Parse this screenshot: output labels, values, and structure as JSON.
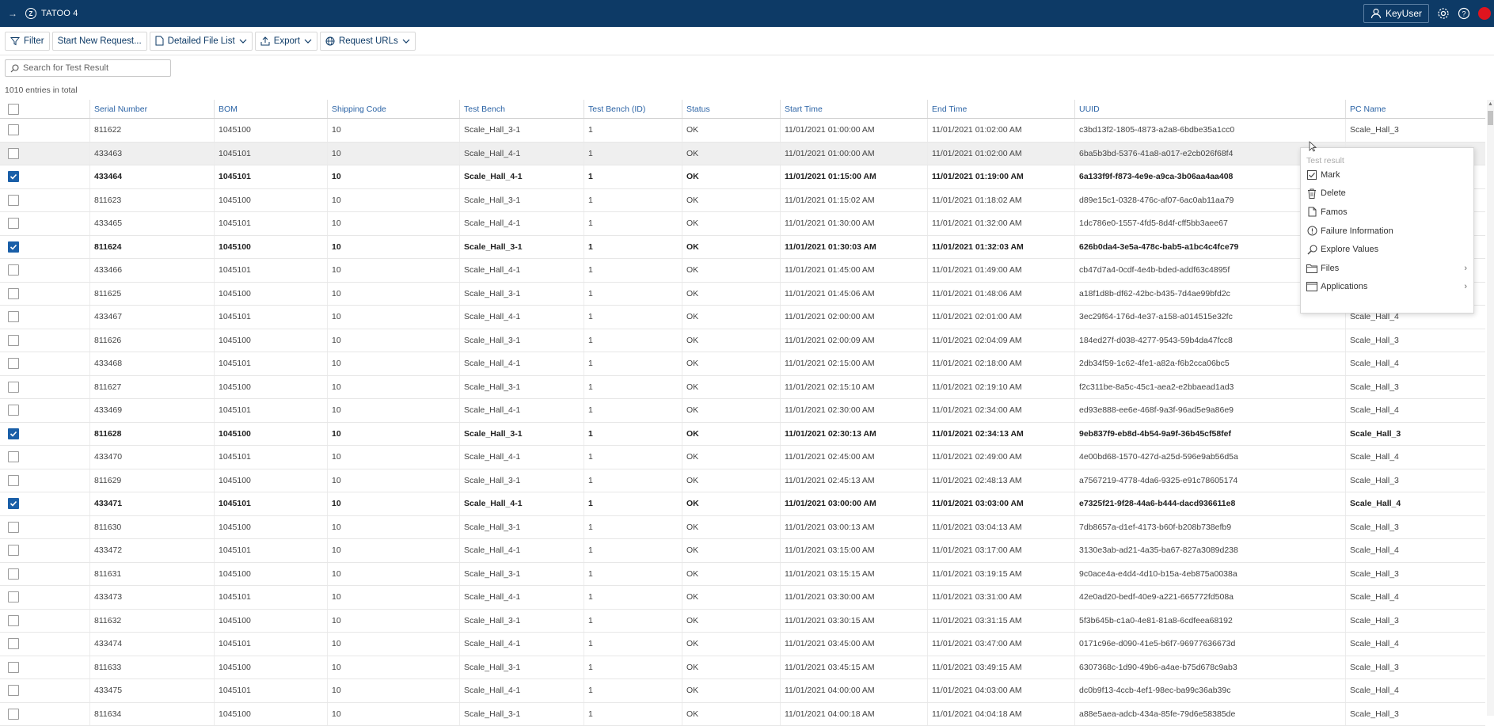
{
  "app": {
    "title": "TATOO 4",
    "user": "KeyUser"
  },
  "toolbar": {
    "filter": "Filter",
    "new_request": "Start New Request...",
    "detailed_file_list": "Detailed File List",
    "export": "Export",
    "request_urls": "Request URLs"
  },
  "search": {
    "placeholder": "Search for Test Result"
  },
  "entries_text": "1010 entries in total",
  "table": {
    "columns": [
      "Serial Number",
      "BOM",
      "Shipping Code",
      "Test Bench",
      "Test Bench (ID)",
      "Status",
      "Start Time",
      "End Time",
      "UUID",
      "PC Name"
    ],
    "rows": [
      {
        "checked": false,
        "cells": [
          "811622",
          "1045100",
          "10",
          "Scale_Hall_3-1",
          "1",
          "OK",
          "11/01/2021 01:00:00 AM",
          "11/01/2021 01:02:00 AM",
          "c3bd13f2-1805-4873-a2a8-6bdbe35a1cc0",
          "Scale_Hall_3"
        ]
      },
      {
        "checked": false,
        "cells": [
          "433463",
          "1045101",
          "10",
          "Scale_Hall_4-1",
          "1",
          "OK",
          "11/01/2021 01:00:00 AM",
          "11/01/2021 01:02:00 AM",
          "6ba5b3bd-5376-41a8-a017-e2cb026f68f4",
          ""
        ]
      },
      {
        "checked": true,
        "cells": [
          "433464",
          "1045101",
          "10",
          "Scale_Hall_4-1",
          "1",
          "OK",
          "11/01/2021 01:15:00 AM",
          "11/01/2021 01:19:00 AM",
          "6a133f9f-f873-4e9e-a9ca-3b06aa4aa408",
          ""
        ]
      },
      {
        "checked": false,
        "cells": [
          "811623",
          "1045100",
          "10",
          "Scale_Hall_3-1",
          "1",
          "OK",
          "11/01/2021 01:15:02 AM",
          "11/01/2021 01:18:02 AM",
          "d89e15c1-0328-476c-af07-6ac0ab11aa79",
          ""
        ]
      },
      {
        "checked": false,
        "cells": [
          "433465",
          "1045101",
          "10",
          "Scale_Hall_4-1",
          "1",
          "OK",
          "11/01/2021 01:30:00 AM",
          "11/01/2021 01:32:00 AM",
          "1dc786e0-1557-4fd5-8d4f-cff5bb3aee67",
          ""
        ]
      },
      {
        "checked": true,
        "cells": [
          "811624",
          "1045100",
          "10",
          "Scale_Hall_3-1",
          "1",
          "OK",
          "11/01/2021 01:30:03 AM",
          "11/01/2021 01:32:03 AM",
          "626b0da4-3e5a-478c-bab5-a1bc4c4fce79",
          ""
        ]
      },
      {
        "checked": false,
        "cells": [
          "433466",
          "1045101",
          "10",
          "Scale_Hall_4-1",
          "1",
          "OK",
          "11/01/2021 01:45:00 AM",
          "11/01/2021 01:49:00 AM",
          "cb47d7a4-0cdf-4e4b-bded-addf63c4895f",
          ""
        ]
      },
      {
        "checked": false,
        "cells": [
          "811625",
          "1045100",
          "10",
          "Scale_Hall_3-1",
          "1",
          "OK",
          "11/01/2021 01:45:06 AM",
          "11/01/2021 01:48:06 AM",
          "a18f1d8b-df62-42bc-b435-7d4ae99bfd2c",
          ""
        ]
      },
      {
        "checked": false,
        "cells": [
          "433467",
          "1045101",
          "10",
          "Scale_Hall_4-1",
          "1",
          "OK",
          "11/01/2021 02:00:00 AM",
          "11/01/2021 02:01:00 AM",
          "3ec29f64-176d-4e37-a158-a014515e32fc",
          "Scale_Hall_4"
        ]
      },
      {
        "checked": false,
        "cells": [
          "811626",
          "1045100",
          "10",
          "Scale_Hall_3-1",
          "1",
          "OK",
          "11/01/2021 02:00:09 AM",
          "11/01/2021 02:04:09 AM",
          "184ed27f-d038-4277-9543-59b4da47fcc8",
          "Scale_Hall_3"
        ]
      },
      {
        "checked": false,
        "cells": [
          "433468",
          "1045101",
          "10",
          "Scale_Hall_4-1",
          "1",
          "OK",
          "11/01/2021 02:15:00 AM",
          "11/01/2021 02:18:00 AM",
          "2db34f59-1c62-4fe1-a82a-f6b2cca06bc5",
          "Scale_Hall_4"
        ]
      },
      {
        "checked": false,
        "cells": [
          "811627",
          "1045100",
          "10",
          "Scale_Hall_3-1",
          "1",
          "OK",
          "11/01/2021 02:15:10 AM",
          "11/01/2021 02:19:10 AM",
          "f2c311be-8a5c-45c1-aea2-e2bbaead1ad3",
          "Scale_Hall_3"
        ]
      },
      {
        "checked": false,
        "cells": [
          "433469",
          "1045101",
          "10",
          "Scale_Hall_4-1",
          "1",
          "OK",
          "11/01/2021 02:30:00 AM",
          "11/01/2021 02:34:00 AM",
          "ed93e888-ee6e-468f-9a3f-96ad5e9a86e9",
          "Scale_Hall_4"
        ]
      },
      {
        "checked": true,
        "cells": [
          "811628",
          "1045100",
          "10",
          "Scale_Hall_3-1",
          "1",
          "OK",
          "11/01/2021 02:30:13 AM",
          "11/01/2021 02:34:13 AM",
          "9eb837f9-eb8d-4b54-9a9f-36b45cf58fef",
          "Scale_Hall_3"
        ]
      },
      {
        "checked": false,
        "cells": [
          "433470",
          "1045101",
          "10",
          "Scale_Hall_4-1",
          "1",
          "OK",
          "11/01/2021 02:45:00 AM",
          "11/01/2021 02:49:00 AM",
          "4e00bd68-1570-427d-a25d-596e9ab56d5a",
          "Scale_Hall_4"
        ]
      },
      {
        "checked": false,
        "cells": [
          "811629",
          "1045100",
          "10",
          "Scale_Hall_3-1",
          "1",
          "OK",
          "11/01/2021 02:45:13 AM",
          "11/01/2021 02:48:13 AM",
          "a7567219-4778-4da6-9325-e91c78605174",
          "Scale_Hall_3"
        ]
      },
      {
        "checked": true,
        "cells": [
          "433471",
          "1045101",
          "10",
          "Scale_Hall_4-1",
          "1",
          "OK",
          "11/01/2021 03:00:00 AM",
          "11/01/2021 03:03:00 AM",
          "e7325f21-9f28-44a6-b444-dacd936611e8",
          "Scale_Hall_4"
        ]
      },
      {
        "checked": false,
        "cells": [
          "811630",
          "1045100",
          "10",
          "Scale_Hall_3-1",
          "1",
          "OK",
          "11/01/2021 03:00:13 AM",
          "11/01/2021 03:04:13 AM",
          "7db8657a-d1ef-4173-b60f-b208b738efb9",
          "Scale_Hall_3"
        ]
      },
      {
        "checked": false,
        "cells": [
          "433472",
          "1045101",
          "10",
          "Scale_Hall_4-1",
          "1",
          "OK",
          "11/01/2021 03:15:00 AM",
          "11/01/2021 03:17:00 AM",
          "3130e3ab-ad21-4a35-ba67-827a3089d238",
          "Scale_Hall_4"
        ]
      },
      {
        "checked": false,
        "cells": [
          "811631",
          "1045100",
          "10",
          "Scale_Hall_3-1",
          "1",
          "OK",
          "11/01/2021 03:15:15 AM",
          "11/01/2021 03:19:15 AM",
          "9c0ace4a-e4d4-4d10-b15a-4eb875a0038a",
          "Scale_Hall_3"
        ]
      },
      {
        "checked": false,
        "cells": [
          "433473",
          "1045101",
          "10",
          "Scale_Hall_4-1",
          "1",
          "OK",
          "11/01/2021 03:30:00 AM",
          "11/01/2021 03:31:00 AM",
          "42e0ad20-bedf-40e9-a221-665772fd508a",
          "Scale_Hall_4"
        ]
      },
      {
        "checked": false,
        "cells": [
          "811632",
          "1045100",
          "10",
          "Scale_Hall_3-1",
          "1",
          "OK",
          "11/01/2021 03:30:15 AM",
          "11/01/2021 03:31:15 AM",
          "5f3b645b-c1a0-4e81-81a8-6cdfeea68192",
          "Scale_Hall_3"
        ]
      },
      {
        "checked": false,
        "cells": [
          "433474",
          "1045101",
          "10",
          "Scale_Hall_4-1",
          "1",
          "OK",
          "11/01/2021 03:45:00 AM",
          "11/01/2021 03:47:00 AM",
          "0171c96e-d090-41e5-b6f7-96977636673d",
          "Scale_Hall_4"
        ]
      },
      {
        "checked": false,
        "cells": [
          "811633",
          "1045100",
          "10",
          "Scale_Hall_3-1",
          "1",
          "OK",
          "11/01/2021 03:45:15 AM",
          "11/01/2021 03:49:15 AM",
          "6307368c-1d90-49b6-a4ae-b75d678c9ab3",
          "Scale_Hall_3"
        ]
      },
      {
        "checked": false,
        "cells": [
          "433475",
          "1045101",
          "10",
          "Scale_Hall_4-1",
          "1",
          "OK",
          "11/01/2021 04:00:00 AM",
          "11/01/2021 04:03:00 AM",
          "dc0b9f13-4ccb-4ef1-98ec-ba99c36ab39c",
          "Scale_Hall_4"
        ]
      },
      {
        "checked": false,
        "cells": [
          "811634",
          "1045100",
          "10",
          "Scale_Hall_3-1",
          "1",
          "OK",
          "11/01/2021 04:00:18 AM",
          "11/01/2021 04:04:18 AM",
          "a88e5aea-adcb-434a-85fe-79d6e58385de",
          "Scale_Hall_3"
        ]
      }
    ]
  },
  "context_menu": {
    "title": "Test result",
    "items": [
      {
        "label": "Mark",
        "icon": "checkbox-icon",
        "submenu": false
      },
      {
        "label": "Delete",
        "icon": "trash-icon",
        "submenu": false
      },
      {
        "label": "Famos",
        "icon": "document-icon",
        "submenu": false
      },
      {
        "label": "Failure Information",
        "icon": "info-circle-icon",
        "submenu": false
      },
      {
        "label": "Explore Values",
        "icon": "magnifier-icon",
        "submenu": false
      },
      {
        "label": "Files",
        "icon": "folder-icon",
        "submenu": true
      },
      {
        "label": "Applications",
        "icon": "window-icon",
        "submenu": true
      }
    ]
  },
  "colors": {
    "appbar": "#0d3a66",
    "accent": "#1a5fa8",
    "header_text": "#2b63a5",
    "close_button": "#e0141e"
  }
}
